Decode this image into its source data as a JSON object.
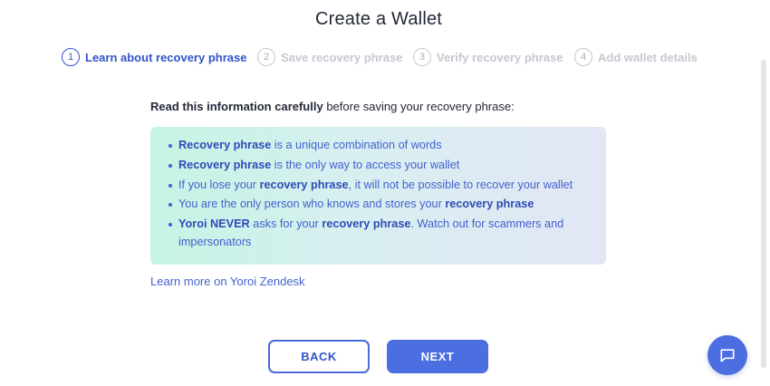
{
  "page": {
    "title": "Create a Wallet"
  },
  "stepper": {
    "steps": [
      {
        "number": "1",
        "label": "Learn about recovery phrase",
        "active": true
      },
      {
        "number": "2",
        "label": "Save recovery phrase",
        "active": false
      },
      {
        "number": "3",
        "label": "Verify recovery phrase",
        "active": false
      },
      {
        "number": "4",
        "label": "Add wallet details",
        "active": false
      }
    ]
  },
  "intro": {
    "bold": "Read this information carefully",
    "rest": " before saving your recovery phrase:"
  },
  "info": {
    "item1": {
      "bold": "Recovery phrase",
      "rest": " is a unique combination of words"
    },
    "item2": {
      "bold": "Recovery phrase",
      "rest": " is the only way to access your wallet"
    },
    "item3": {
      "pre": "If you lose your ",
      "bold": "recovery phrase",
      "rest": ", it will not be possible to recover your wallet"
    },
    "item4": {
      "pre": "You are the only person who knows and stores your ",
      "bold": "recovery phrase"
    },
    "item5": {
      "bold": "Yoroi NEVER",
      "mid": " asks for your ",
      "bold2": "recovery phrase",
      "rest": ". Watch out for scammers and impersonators"
    }
  },
  "link": {
    "label": "Learn more on Yoroi Zendesk"
  },
  "buttons": {
    "back": "BACK",
    "next": "NEXT"
  },
  "colors": {
    "primary": "#3154cb",
    "button_fill": "#4b6ee0",
    "inactive": "#c4c8d1",
    "gradient_start": "#c5f4e4",
    "gradient_end": "#e2e6f5"
  },
  "icons": {
    "chat": "chat-bubble-icon"
  }
}
